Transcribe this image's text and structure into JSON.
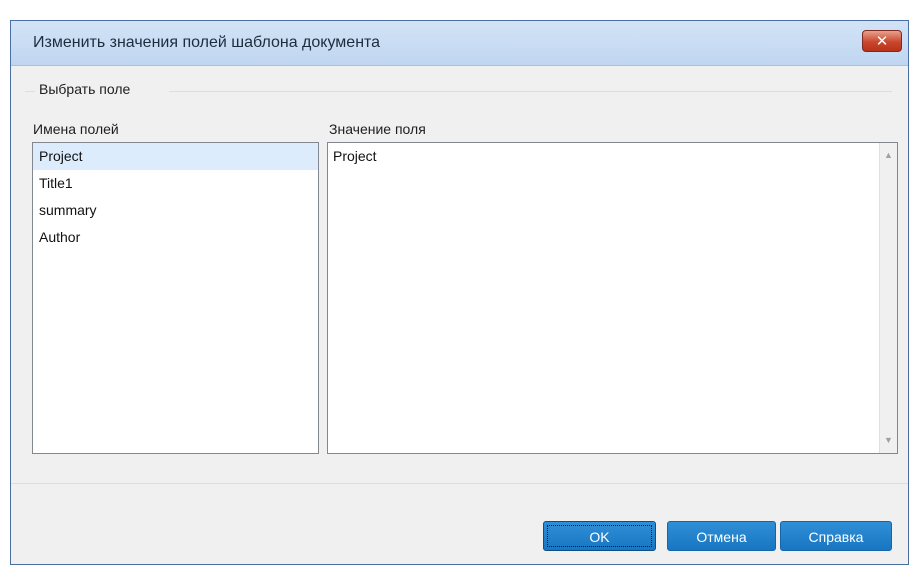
{
  "window": {
    "title": "Изменить значения полей шаблона документа",
    "close_label": "✕"
  },
  "group": {
    "label": "Выбрать поле"
  },
  "fields": {
    "header": "Имена полей",
    "items": [
      "Project",
      "Title1",
      "summary",
      "Author"
    ],
    "selected_index": 0
  },
  "value": {
    "header": "Значение поля",
    "text": "Project"
  },
  "buttons": {
    "ok": "OK",
    "cancel": "Отмена",
    "help": "Справка"
  },
  "colors": {
    "button": "#1f7fc9",
    "selection": "#dcecfc",
    "close": "#c9472d"
  }
}
